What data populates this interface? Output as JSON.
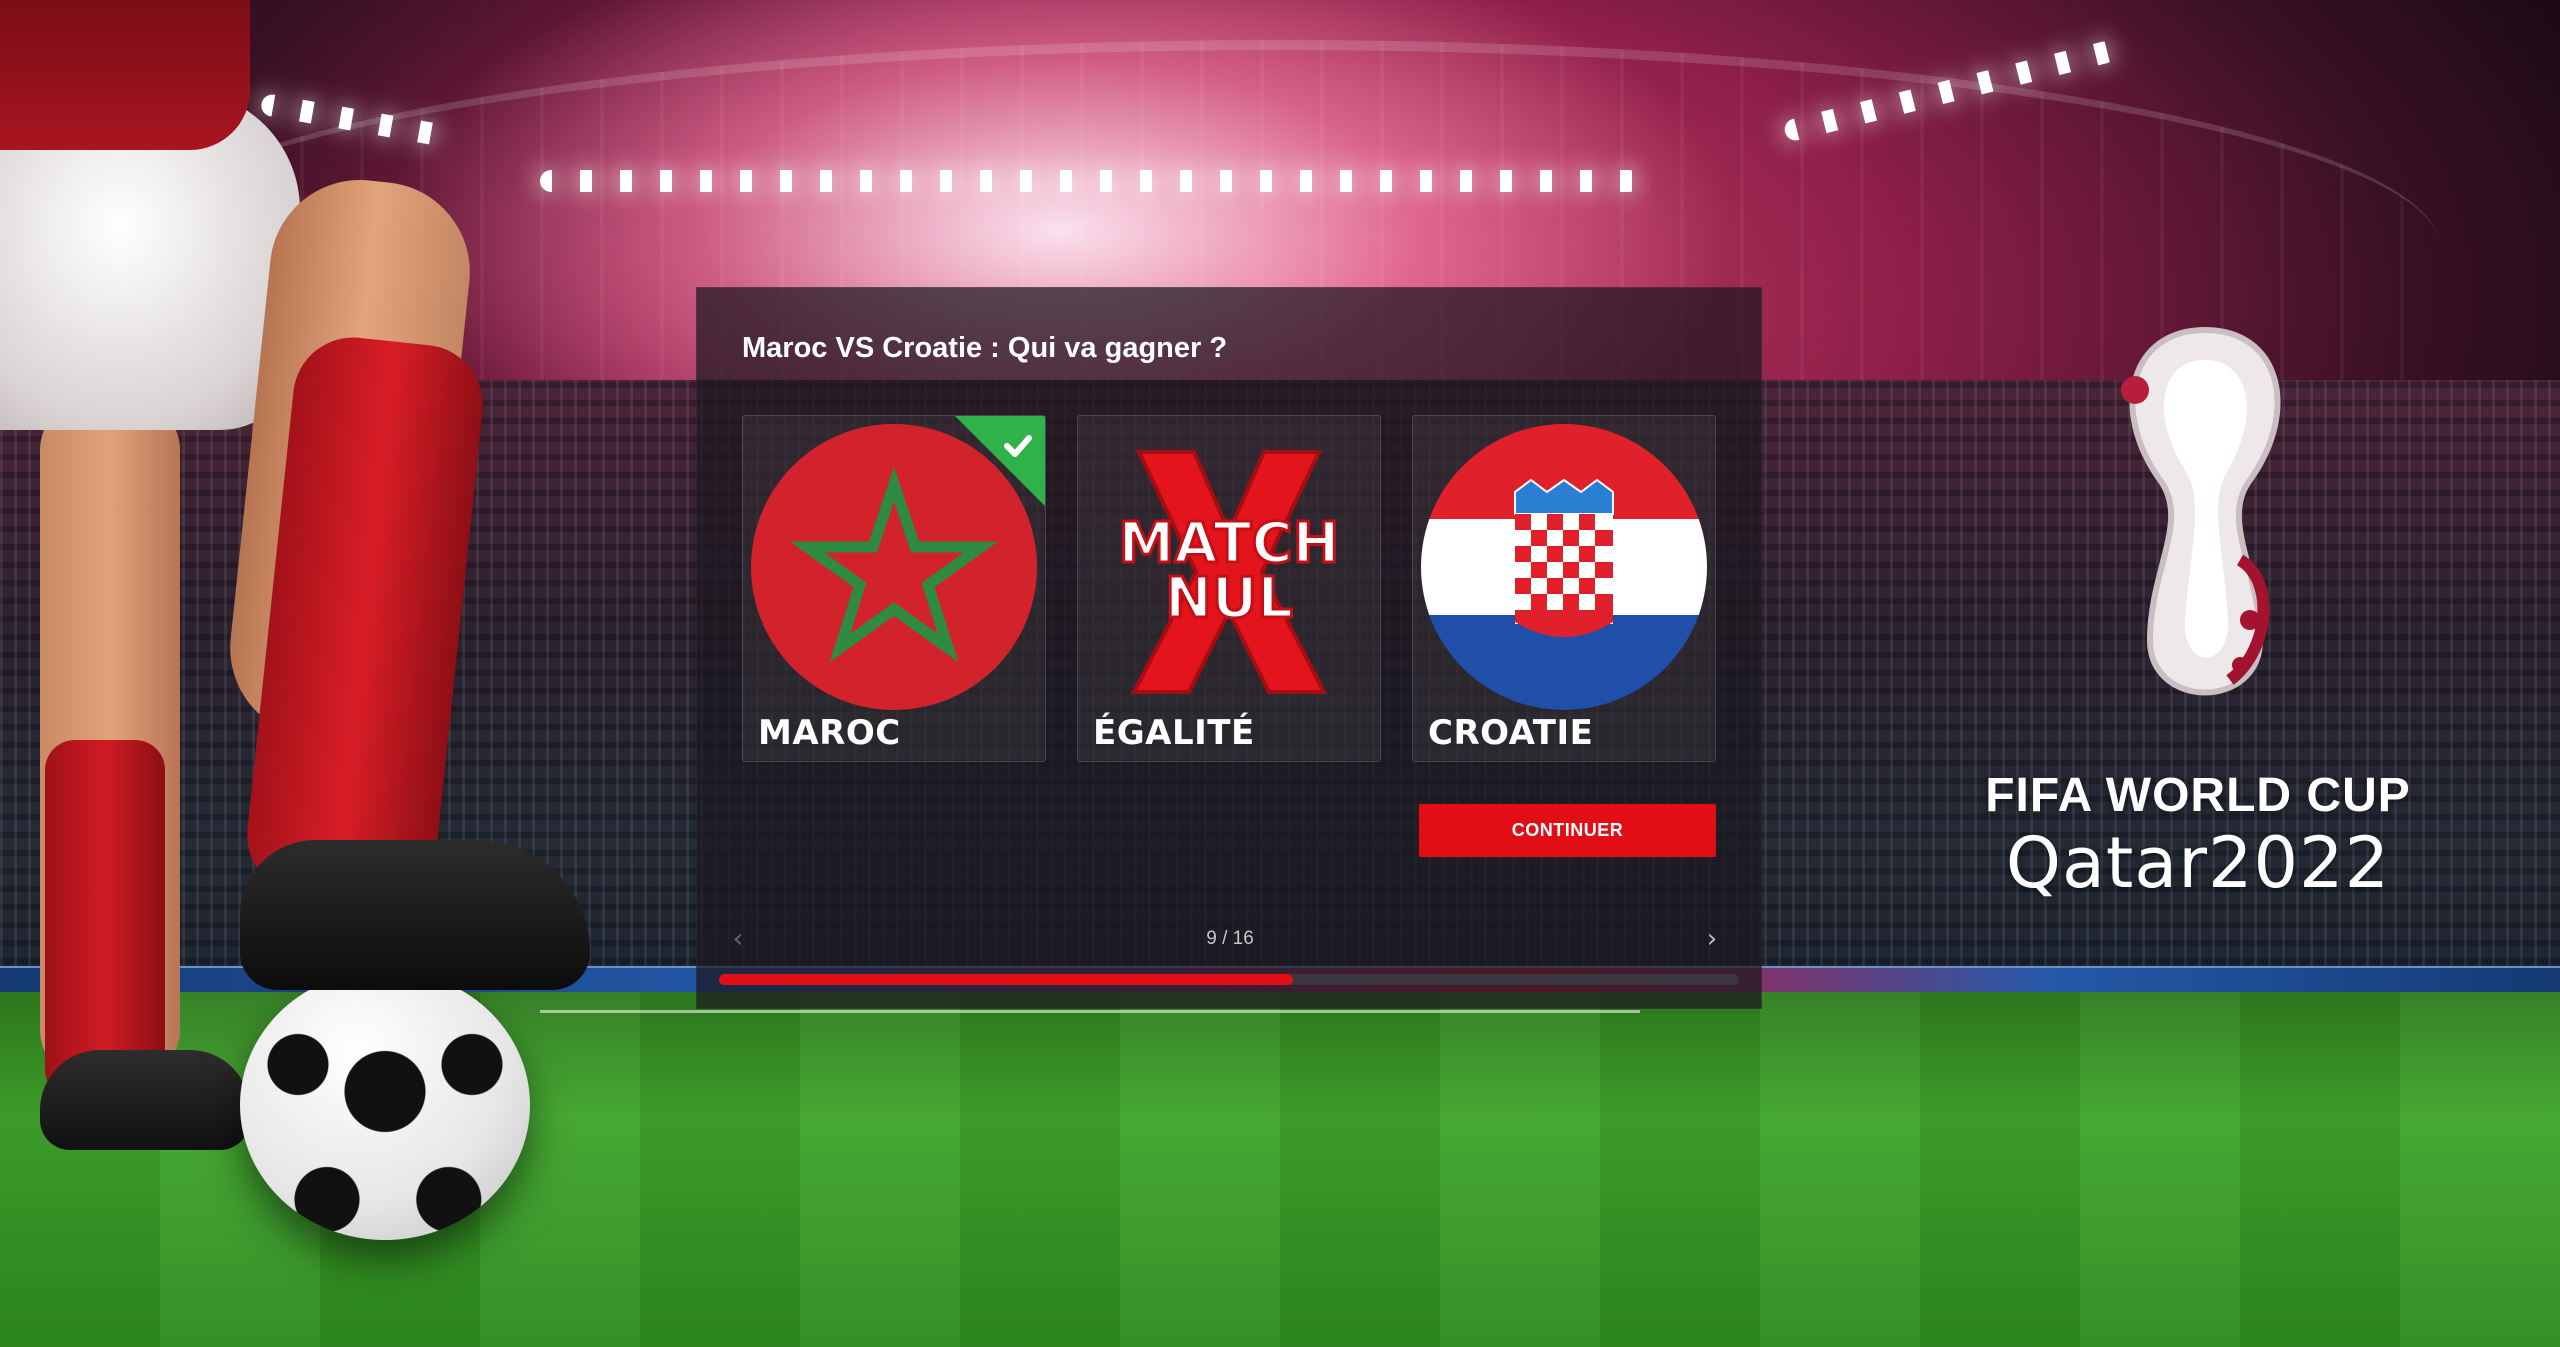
{
  "quiz": {
    "question": "Maroc VS Croatie : Qui va gagner ?",
    "options": [
      {
        "label": "MAROC",
        "selected": true
      },
      {
        "label": "ÉGALITÉ",
        "image_text_top": "MATCH",
        "image_text_bottom": "NUL",
        "selected": false
      },
      {
        "label": "CROATIE",
        "selected": false
      }
    ],
    "continue_label": "CONTINUER",
    "counter": "9 / 16",
    "progress_fraction": 0.5625,
    "accent_color": "#e10f15",
    "check_color": "#2fb24a"
  },
  "branding": {
    "title": "FIFA WORLD CUP",
    "subtitle": "Qatar2022"
  },
  "icons": {
    "prev": "chevron-left-icon",
    "next": "chevron-right-icon",
    "check": "check-icon"
  }
}
